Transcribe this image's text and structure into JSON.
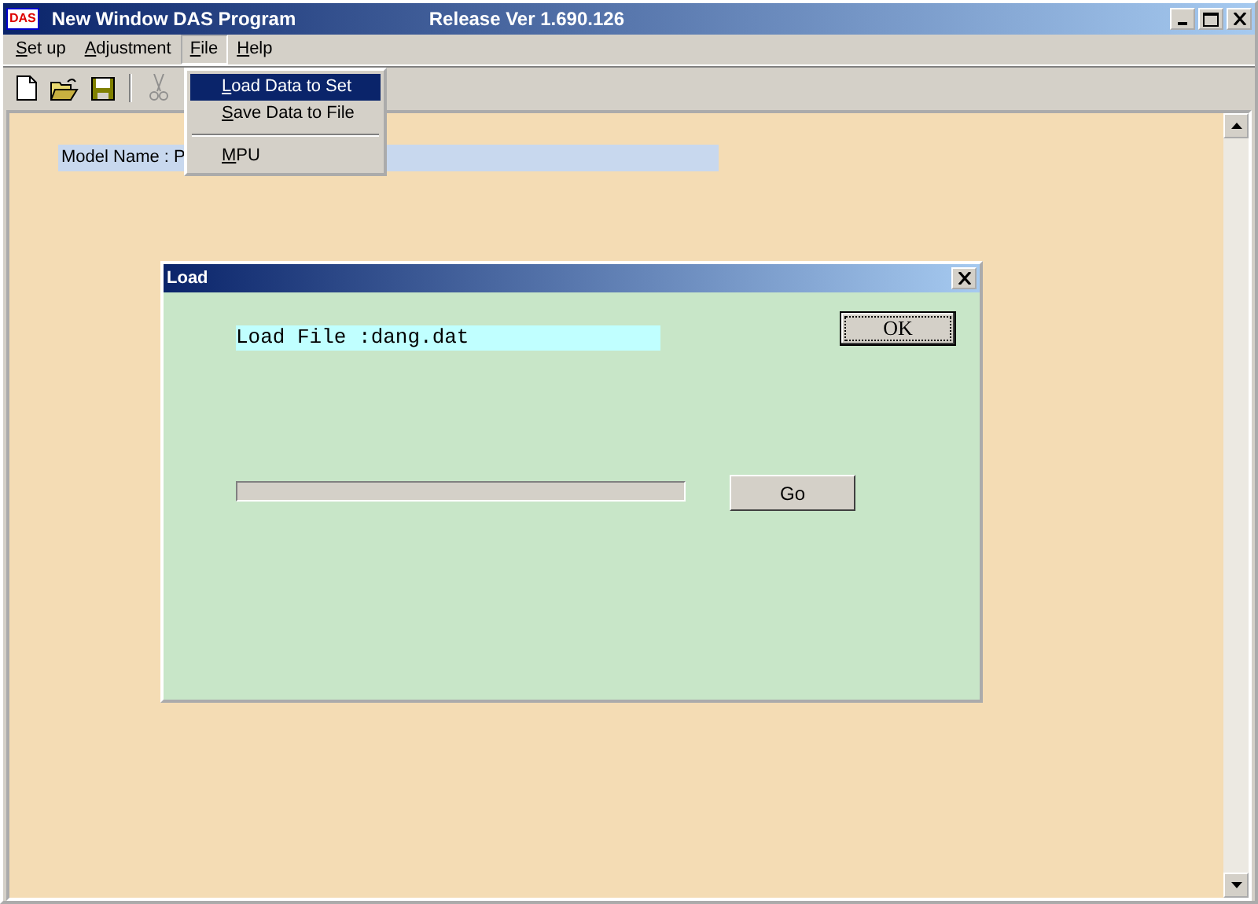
{
  "window": {
    "title": "New Window DAS Program",
    "release": "Release Ver 1.690.126",
    "app_icon_text": "DAS"
  },
  "menu": [
    {
      "label": "Set up",
      "selected": false
    },
    {
      "label": "Adjustment",
      "selected": false
    },
    {
      "label": "File",
      "selected": true
    },
    {
      "label": "Help",
      "selected": false
    }
  ],
  "toolbar": [
    {
      "kind": "new",
      "disabled": false
    },
    {
      "kind": "open",
      "disabled": false
    },
    {
      "kind": "save",
      "disabled": false
    },
    {
      "kind": "separator"
    },
    {
      "kind": "cut",
      "disabled": true
    }
  ],
  "dropdown": [
    {
      "kind": "item",
      "label": "Load Data to Set",
      "selected": true
    },
    {
      "kind": "item",
      "label": "Save Data to File",
      "selected": false
    },
    {
      "kind": "separator"
    },
    {
      "kind": "item",
      "label": "MPU",
      "selected": false
    }
  ],
  "model_name": "Model Name : P",
  "dialog": {
    "title": "Load",
    "load_file": "Load File :dang.dat",
    "ok": "OK",
    "go": "Go",
    "progress": {
      "level": 0
    }
  }
}
